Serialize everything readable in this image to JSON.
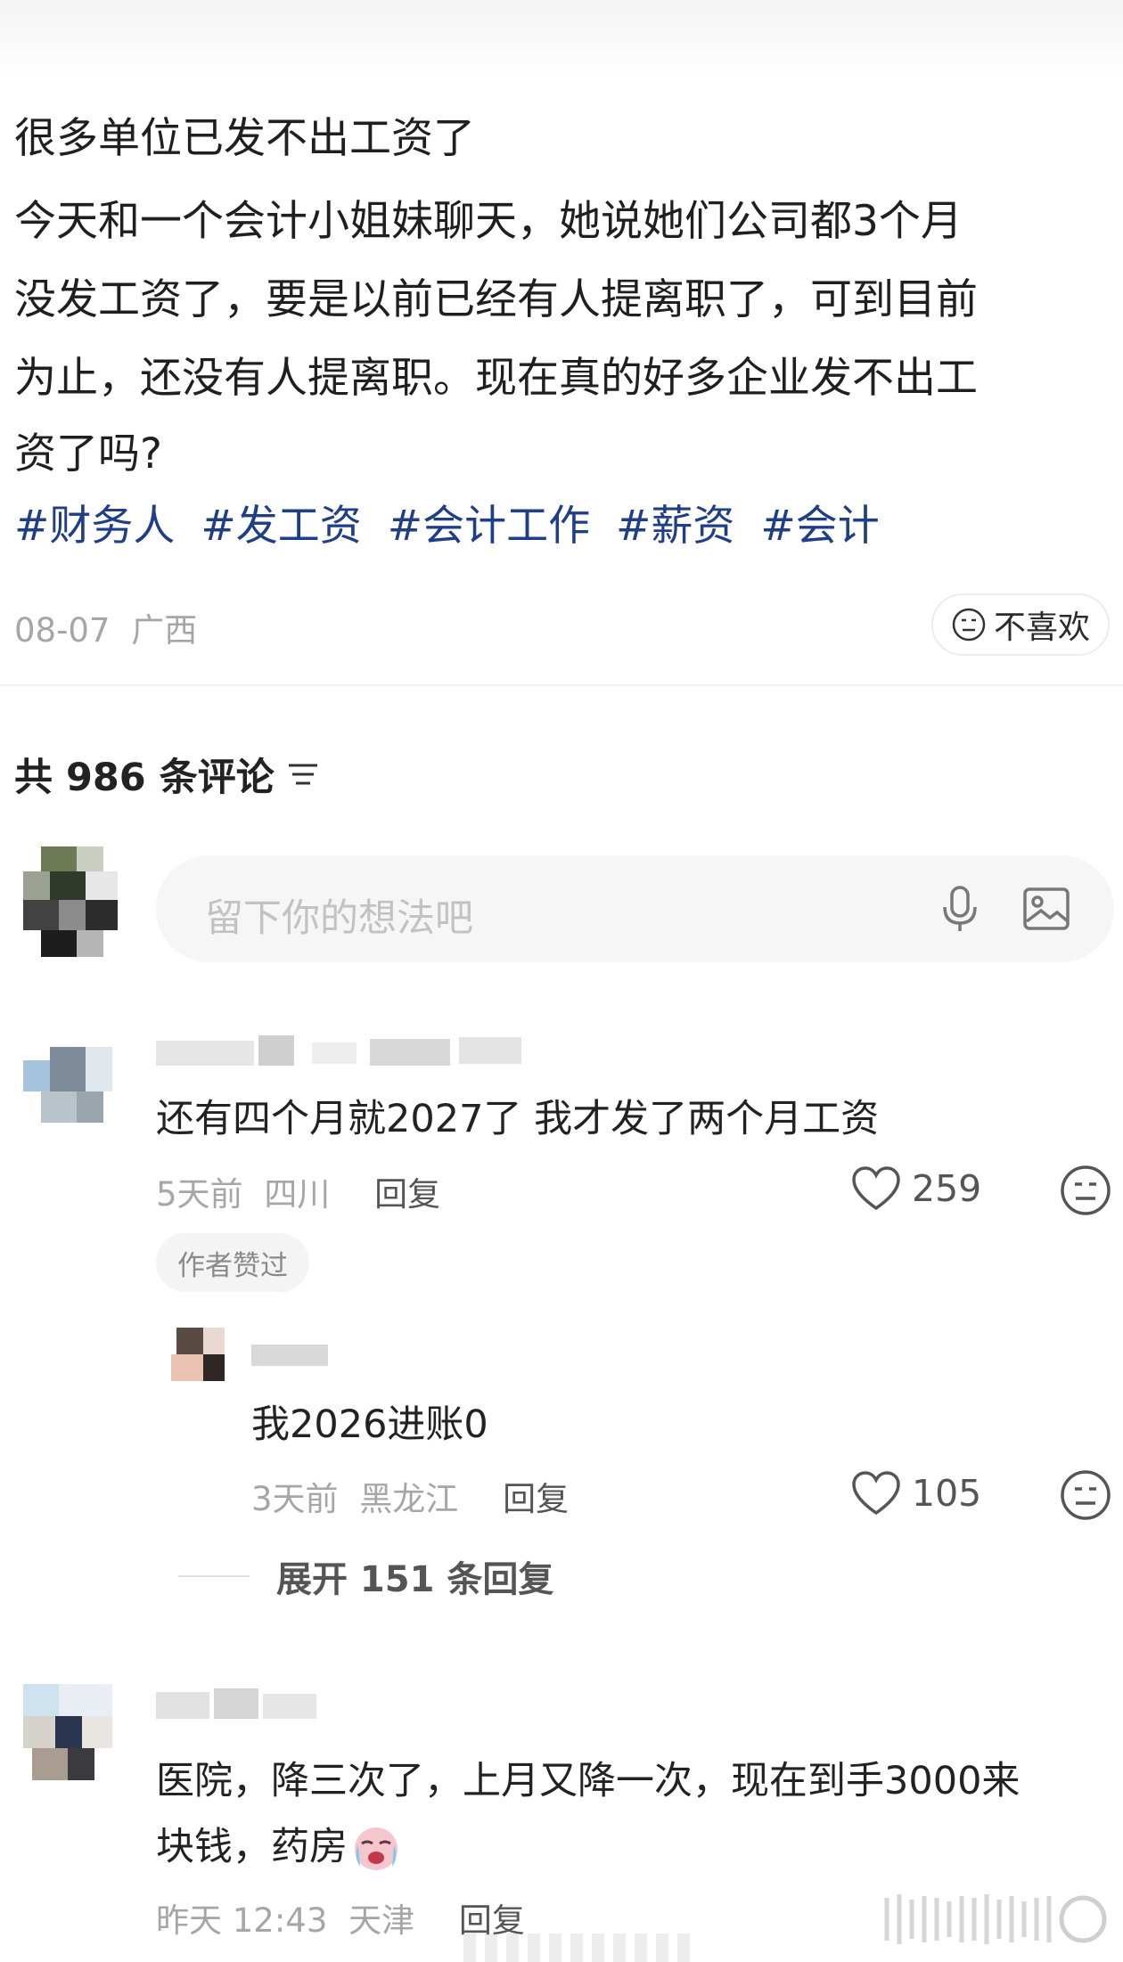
{
  "post": {
    "title": "很多单位已发不出工资了",
    "body_lines": [
      "今天和一个会计小姐妹聊天，她说她们公司都3个月",
      "没发工资了，要是以前已经有人提离职了，可到目前",
      "为止，还没有人提离职。现在真的好多企业发不出工",
      "资了吗?"
    ],
    "tags": [
      "#财务人",
      "#发工资",
      "#会计工作",
      "#薪资",
      "#会计"
    ],
    "date": "08-07",
    "location": "广西",
    "dislike_label": "不喜欢"
  },
  "comments_section": {
    "header": "共 986 条评论",
    "input_placeholder": "留下你的想法吧"
  },
  "comments": [
    {
      "text": "还有四个月就2027了  我才发了两个月工资",
      "time": "5天前",
      "location": "四川",
      "reply_label": "回复",
      "likes": "259",
      "badge": "作者赞过",
      "reply": {
        "text": "我2026进账0",
        "time": "3天前",
        "location": "黑龙江",
        "reply_label": "回复",
        "likes": "105"
      },
      "expand_label": "展开 151 条回复"
    },
    {
      "text_line1": "医院，降三次了，上月又降一次，现在到手3000来",
      "text_line2": "块钱，药房",
      "time": "昨天 12:43",
      "location": "天津",
      "reply_label": "回复"
    }
  ],
  "icons": {
    "sort": "sort-lines-icon",
    "mic": "microphone-icon",
    "image": "image-icon",
    "dislike": "neutral-face-icon",
    "like": "heart-icon",
    "crying_emoji": "crying-face-emoji"
  },
  "colors": {
    "tag": "#1e3f87",
    "meta_gray": "#a6a6a6",
    "input_bg": "#f6f6f6"
  }
}
